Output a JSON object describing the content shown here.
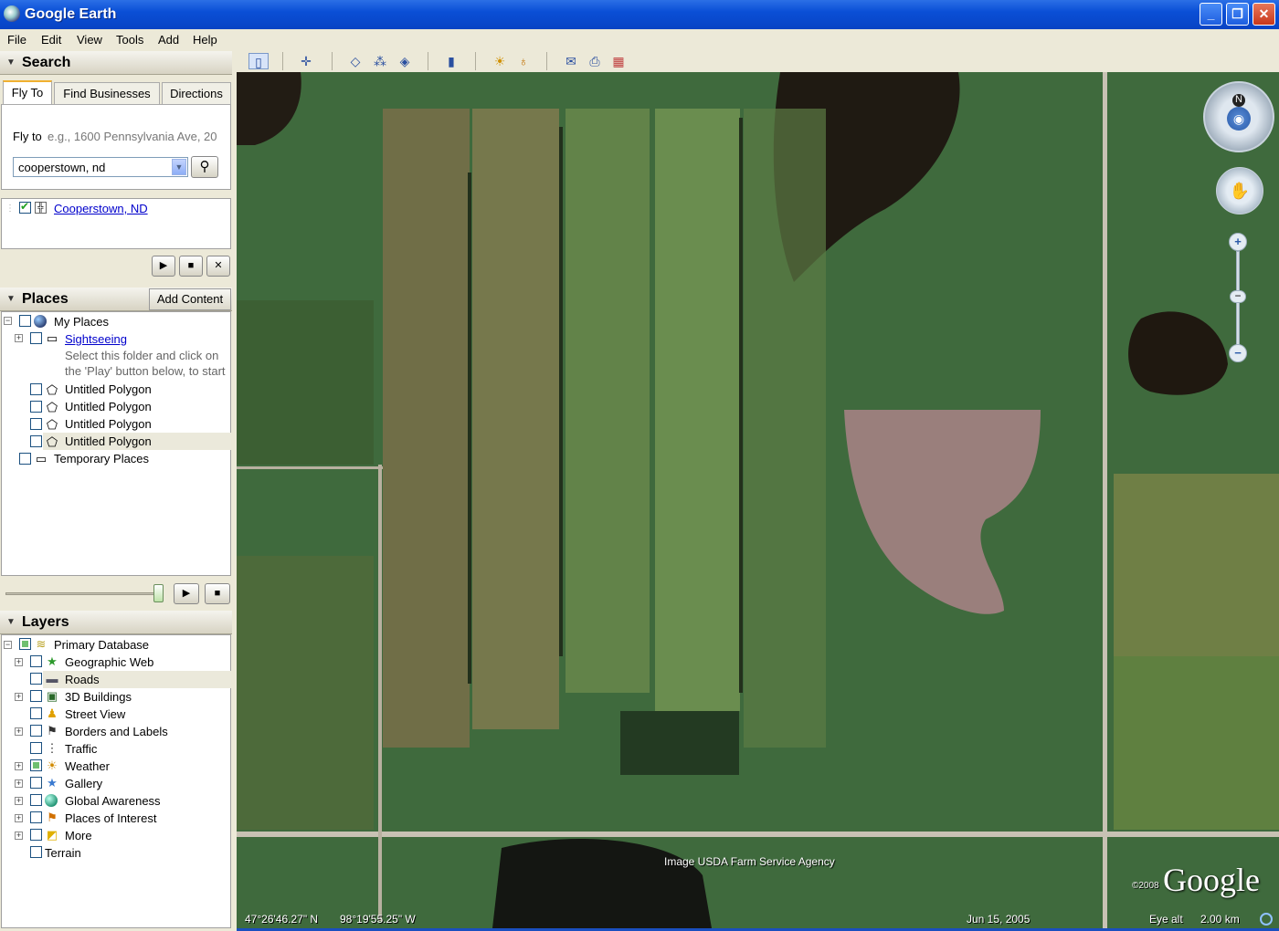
{
  "window": {
    "title": "Google Earth",
    "minimize": "_",
    "maximize": "❐",
    "close": "✕"
  },
  "menu": [
    "File",
    "Edit",
    "View",
    "Tools",
    "Add",
    "Help"
  ],
  "search": {
    "header": "Search",
    "tabs": [
      "Fly To",
      "Find Businesses",
      "Directions"
    ],
    "fly_to_label": "Fly to",
    "fly_to_hint": "e.g., 1600 Pennsylvania Ave, 20",
    "input_value": "cooperstown, nd",
    "result": "Cooperstown, ND"
  },
  "places": {
    "header": "Places",
    "add_content": "Add Content",
    "items": {
      "my_places": "My Places",
      "sightseeing": "Sightseeing",
      "sightseeing_desc1": "Select this folder and click on",
      "sightseeing_desc2": "the 'Play' button below, to start",
      "poly1": "Untitled Polygon",
      "poly2": "Untitled Polygon",
      "poly3": "Untitled Polygon",
      "poly4": "Untitled Polygon",
      "temporary": "Temporary Places"
    }
  },
  "layers": {
    "header": "Layers",
    "items": {
      "primary": "Primary Database",
      "geoweb": "Geographic Web",
      "roads": "Roads",
      "buildings": "3D Buildings",
      "streetview": "Street View",
      "borders": "Borders and Labels",
      "traffic": "Traffic",
      "weather": "Weather",
      "gallery": "Gallery",
      "global": "Global Awareness",
      "poi": "Places of Interest",
      "more": "More",
      "terrain": "Terrain"
    }
  },
  "map": {
    "credit": "Image USDA Farm Service Agency",
    "copyright": "©2008",
    "logo": "Google",
    "lat": "47°26'46.27\" N",
    "lon": "98°19'55.25\" W",
    "date": "Jun 15, 2005",
    "eye_alt_label": "Eye alt",
    "eye_alt_value": "2.00 km",
    "compass_north": "N"
  },
  "icons": {
    "play": "▶",
    "stop": "■",
    "close": "✕",
    "search": "⚲"
  }
}
